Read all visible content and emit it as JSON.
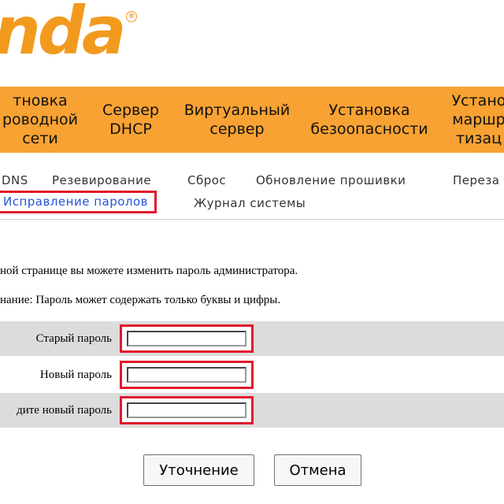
{
  "logo": {
    "text": "nda",
    "reg": "®"
  },
  "main_nav": [
    "тновка\nроводной\nсети",
    "Сервер\nDHCP",
    "Виртуальный\nсервер",
    "Установка\nбезоопасности",
    "Устано\nмаршр\nтизац"
  ],
  "sub_nav": {
    "row1": [
      "DNS",
      "Резевирование",
      "Сброс",
      "Обновление прошивки",
      "Переза"
    ],
    "row2": [
      "Исправление паролов",
      "Журнал системы"
    ]
  },
  "info": {
    "line1": "ной странице вы можете изменить пароль администратора.",
    "line2": "нание: Пароль может содержать только буквы и цифры."
  },
  "form": {
    "old_label": "Старый пароль",
    "new_label": "Новый пароль",
    "confirm_label": "дите новый пароль",
    "old_value": "",
    "new_value": "",
    "confirm_value": ""
  },
  "buttons": {
    "apply": "Уточнение",
    "cancel": "Отмена"
  },
  "colors": {
    "accent": "#f8a233",
    "highlight": "#e1182a",
    "link_active": "#2753d8"
  }
}
